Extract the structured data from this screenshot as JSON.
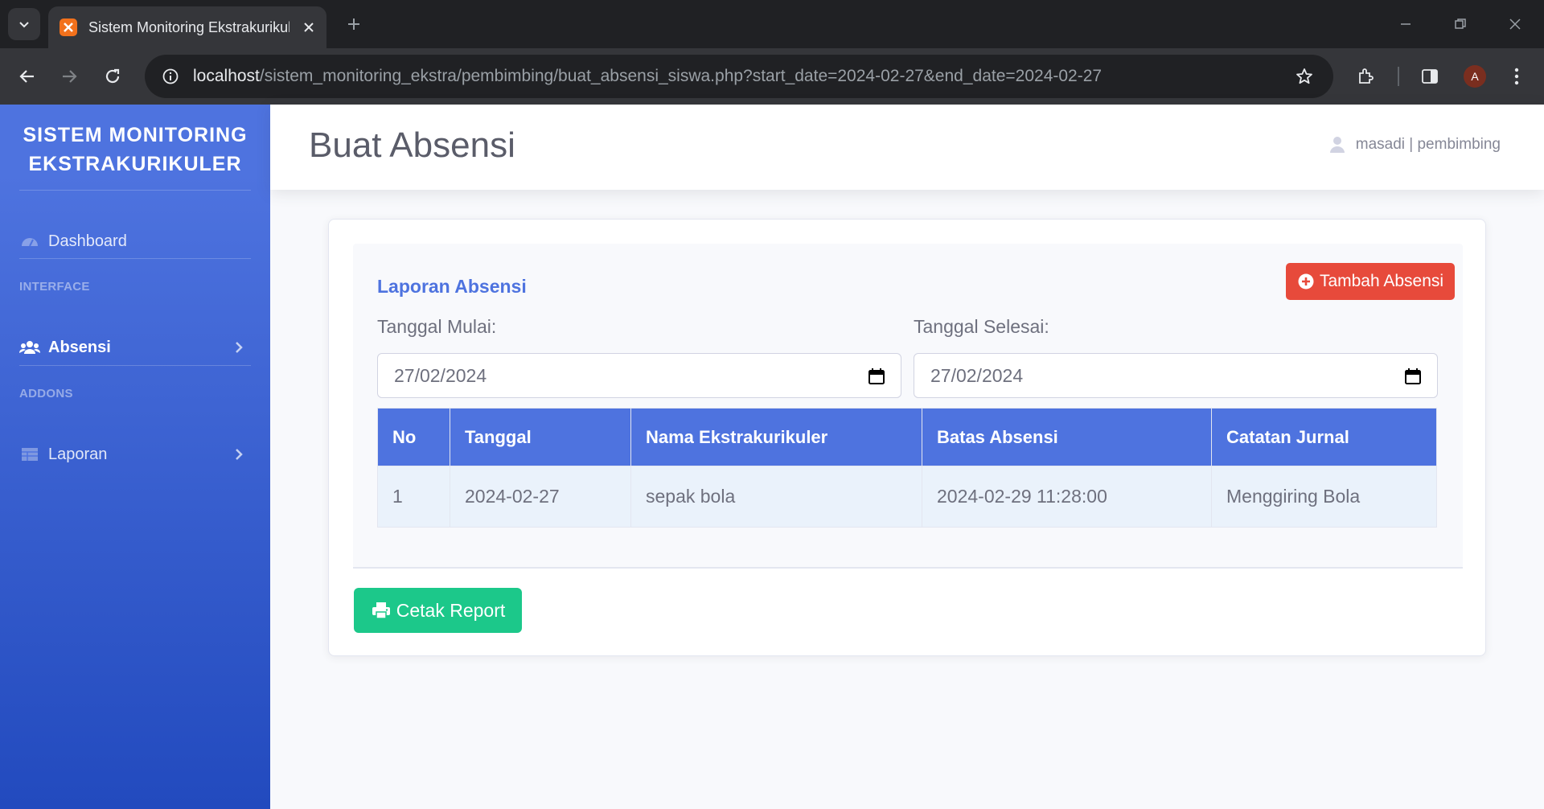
{
  "browser": {
    "tab_title": "Sistem Monitoring Ekstrakurikuler",
    "url_host": "localhost",
    "url_path": "/sistem_monitoring_ekstra/pembimbing/buat_absensi_siswa.php?start_date=2024-02-27&end_date=2024-02-27",
    "profile_initial": "A"
  },
  "sidebar": {
    "brand_line1": "SISTEM MONITORING",
    "brand_line2": "EKSTRAKURIKULER",
    "dashboard": "Dashboard",
    "heading_interface": "INTERFACE",
    "absensi": "Absensi",
    "heading_addons": "ADDONS",
    "laporan": "Laporan"
  },
  "topbar": {
    "page_title": "Buat Absensi",
    "user": "masadi | pembimbing"
  },
  "report": {
    "title": "Laporan Absensi",
    "add_button": "Tambah Absensi",
    "start_label": "Tanggal Mulai:",
    "start_value": "27/02/2024",
    "end_label": "Tanggal Selesai:",
    "end_value": "27/02/2024",
    "columns": [
      "No",
      "Tanggal",
      "Nama Ekstrakurikuler",
      "Batas Absensi",
      "Catatan Jurnal"
    ],
    "rows": [
      [
        "1",
        "2024-02-27",
        "sepak bola",
        "2024-02-29 11:28:00",
        "Menggiring Bola"
      ]
    ],
    "print_button": "Cetak Report"
  },
  "colors": {
    "primary": "#4e73df",
    "danger": "#e74a3b",
    "success": "#1cc88a"
  }
}
